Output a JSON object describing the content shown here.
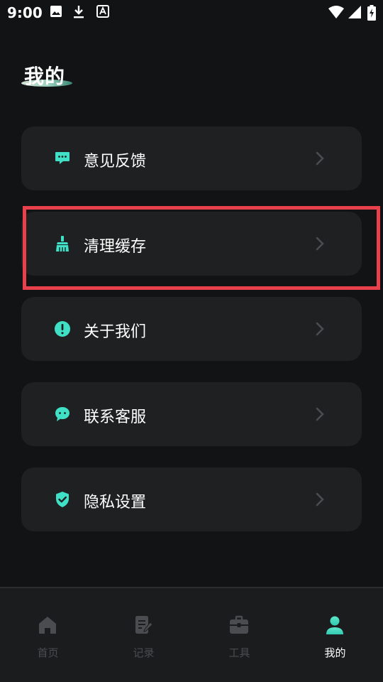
{
  "status_bar": {
    "time": "9:00"
  },
  "page": {
    "title": "我的"
  },
  "menu": [
    {
      "label": "意见反馈",
      "icon": "feedback-chat-icon"
    },
    {
      "label": "清理缓存",
      "icon": "broom-icon"
    },
    {
      "label": "关于我们",
      "icon": "info-exclamation-icon"
    },
    {
      "label": "联系客服",
      "icon": "customer-service-chat-icon"
    },
    {
      "label": "隐私设置",
      "icon": "shield-check-icon"
    }
  ],
  "bottom_nav": [
    {
      "label": "首页",
      "icon": "home-icon",
      "active": false
    },
    {
      "label": "记录",
      "icon": "note-edit-icon",
      "active": false
    },
    {
      "label": "工具",
      "icon": "toolbox-icon",
      "active": false
    },
    {
      "label": "我的",
      "icon": "user-icon",
      "active": true
    }
  ],
  "colors": {
    "background": "#121314",
    "card": "#1e2021",
    "accent": "#3fe0c5",
    "highlight": "#e8414b",
    "inactive": "#4a4c4f"
  }
}
